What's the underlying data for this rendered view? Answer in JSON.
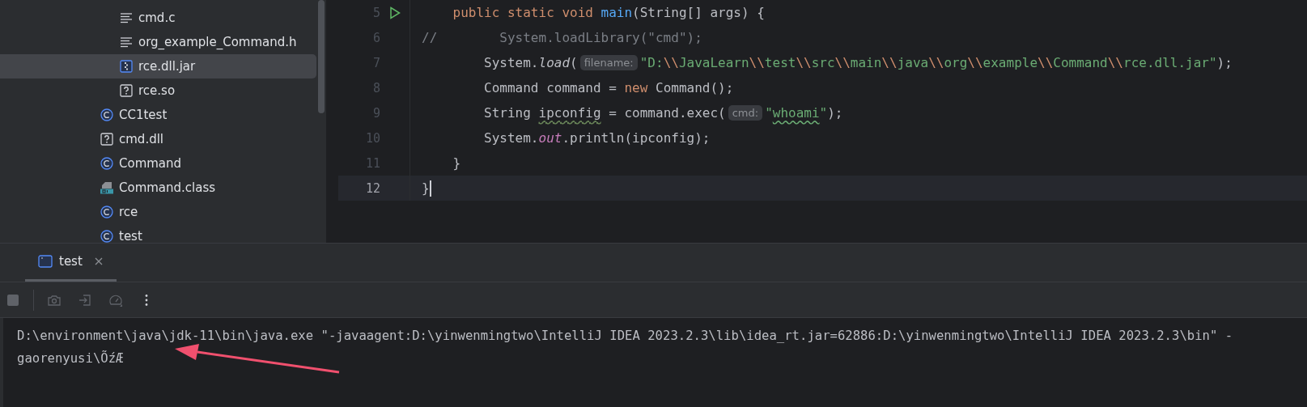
{
  "project_tree": {
    "items": [
      {
        "children": [
          {
            "label": "cmd.c",
            "kind": "text-file",
            "selected": false
          },
          {
            "label": "org_example_Command.h",
            "kind": "text-file",
            "selected": false
          },
          {
            "label": "rce.dll.jar",
            "kind": "jar",
            "selected": true
          },
          {
            "label": "rce.so",
            "kind": "unknown",
            "selected": false
          }
        ]
      },
      {
        "label": "CC1test",
        "kind": "class",
        "selected": false
      },
      {
        "label": "cmd.dll",
        "kind": "unknown",
        "selected": false
      },
      {
        "label": "Command",
        "kind": "class",
        "selected": false
      },
      {
        "label": "Command.class",
        "kind": "compiled-class",
        "selected": false
      },
      {
        "label": "rce",
        "kind": "class",
        "selected": false
      },
      {
        "label": "test",
        "kind": "class",
        "selected": false
      }
    ]
  },
  "editor": {
    "lines": [
      {
        "number": "5",
        "run_marker": true,
        "current": false,
        "tokens": [
          {
            "kind": "keyword",
            "text": "    public static void"
          },
          {
            "kind": "method",
            "text": " main"
          },
          {
            "kind": "plain",
            "text": "(String[] args) {"
          }
        ]
      },
      {
        "number": "6",
        "run_marker": false,
        "current": false,
        "tokens": [
          {
            "kind": "comment",
            "text": "//        System.loadLibrary(\"cmd\");"
          }
        ]
      },
      {
        "number": "7",
        "run_marker": false,
        "current": false,
        "tokens": [
          {
            "kind": "plain",
            "text": "        System."
          },
          {
            "kind": "italic",
            "text": "load"
          },
          {
            "kind": "plain",
            "text": "("
          },
          {
            "kind": "hint",
            "text": "filename:"
          },
          {
            "kind": "string",
            "text": "\"D:"
          },
          {
            "kind": "escape",
            "text": "\\\\"
          },
          {
            "kind": "string",
            "text": "JavaLearn"
          },
          {
            "kind": "escape",
            "text": "\\\\"
          },
          {
            "kind": "string",
            "text": "test"
          },
          {
            "kind": "escape",
            "text": "\\\\"
          },
          {
            "kind": "string",
            "text": "src"
          },
          {
            "kind": "escape",
            "text": "\\\\"
          },
          {
            "kind": "string",
            "text": "main"
          },
          {
            "kind": "escape",
            "text": "\\\\"
          },
          {
            "kind": "string",
            "text": "java"
          },
          {
            "kind": "escape",
            "text": "\\\\"
          },
          {
            "kind": "string",
            "text": "org"
          },
          {
            "kind": "escape",
            "text": "\\\\"
          },
          {
            "kind": "string",
            "text": "example"
          },
          {
            "kind": "escape",
            "text": "\\\\"
          },
          {
            "kind": "string",
            "text": "Command"
          },
          {
            "kind": "escape",
            "text": "\\\\"
          },
          {
            "kind": "string",
            "text": "rce.dll.jar\""
          },
          {
            "kind": "plain",
            "text": ");"
          }
        ]
      },
      {
        "number": "8",
        "run_marker": false,
        "current": false,
        "tokens": [
          {
            "kind": "plain",
            "text": "        Command command = "
          },
          {
            "kind": "keyword",
            "text": "new"
          },
          {
            "kind": "plain",
            "text": " Command();"
          }
        ]
      },
      {
        "number": "9",
        "run_marker": false,
        "current": false,
        "tokens": [
          {
            "kind": "plain",
            "text": "        String "
          },
          {
            "kind": "warning",
            "text": "ipconfig"
          },
          {
            "kind": "plain",
            "text": " = command.exec("
          },
          {
            "kind": "hint",
            "text": "cmd:"
          },
          {
            "kind": "string",
            "text": "\""
          },
          {
            "kind": "typo",
            "text": "whoami"
          },
          {
            "kind": "string",
            "text": "\""
          },
          {
            "kind": "plain",
            "text": ");"
          }
        ]
      },
      {
        "number": "10",
        "run_marker": false,
        "current": false,
        "tokens": [
          {
            "kind": "plain",
            "text": "        System."
          },
          {
            "kind": "field",
            "text": "out"
          },
          {
            "kind": "plain",
            "text": ".println(ipconfig);"
          }
        ]
      },
      {
        "number": "11",
        "run_marker": false,
        "current": false,
        "tokens": [
          {
            "kind": "plain",
            "text": "    }"
          }
        ]
      },
      {
        "number": "12",
        "run_marker": false,
        "current": true,
        "tokens": [
          {
            "kind": "plain",
            "text": "}"
          }
        ]
      }
    ]
  },
  "run_panel": {
    "tabs": [
      {
        "label": "test",
        "selected": true
      }
    ],
    "toolbar": [
      {
        "kind": "stop",
        "disabled": true
      },
      {
        "kind": "camera",
        "disabled": true
      },
      {
        "kind": "exit",
        "disabled": true
      },
      {
        "kind": "gauge",
        "disabled": true
      },
      {
        "kind": "more",
        "disabled": false
      }
    ],
    "console_lines": [
      "D:\\environment\\java\\jdk-11\\bin\\java.exe \"-javaagent:D:\\yinwenmingtwo\\IntelliJ IDEA 2023.2.3\\lib\\idea_rt.jar=62886:D:\\yinwenmingtwo\\IntelliJ IDEA 2023.2.3\\bin\" -",
      "gaorenyusi\\ÕźÆ"
    ]
  }
}
